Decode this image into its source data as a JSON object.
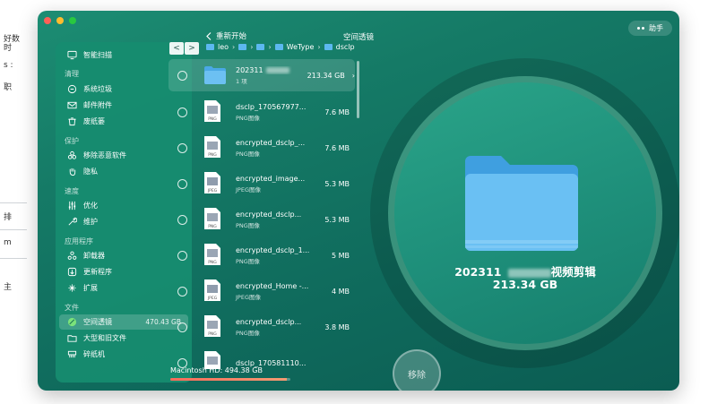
{
  "background_window": {
    "fragments": [
      "好数",
      "时",
      "s :",
      "职",
      "排",
      "m",
      "主"
    ]
  },
  "app": {
    "window_title": "空间透镜",
    "back_label": "重新开始",
    "assistant_label": "助手",
    "accent_color": "#157a66"
  },
  "sidebar": {
    "top_item": "智能扫描",
    "sections": [
      {
        "title": "清理",
        "items": [
          "系统垃圾",
          "邮件附件",
          "废纸篓"
        ]
      },
      {
        "title": "保护",
        "items": [
          "移除恶意软件",
          "隐私"
        ]
      },
      {
        "title": "速度",
        "items": [
          "优化",
          "维护"
        ]
      },
      {
        "title": "应用程序",
        "items": [
          "卸载器",
          "更新程序",
          "扩展"
        ]
      },
      {
        "title": "文件",
        "items": [
          "空间透镜",
          "大型和旧文件",
          "碎纸机"
        ]
      }
    ],
    "active_item_meta": "470.43 GB"
  },
  "breadcrumb": {
    "back_arrow": "<",
    "forward_arrow": ">",
    "items": [
      "leo",
      "",
      "",
      "WeType",
      "dsclp"
    ]
  },
  "files": [
    {
      "name": "202311",
      "sub": "1 项",
      "size": "213.34 GB",
      "type": "folder"
    },
    {
      "name": "dsclp_170567977...",
      "sub": "PNG图像",
      "size": "7.6 MB",
      "type": "png"
    },
    {
      "name": "encrypted_dsclp_...",
      "sub": "PNG图像",
      "size": "7.6 MB",
      "type": "png"
    },
    {
      "name": "encrypted_image...",
      "sub": "JPEG图像",
      "size": "5.3 MB",
      "type": "jpeg"
    },
    {
      "name": "encrypted_dsclp...",
      "sub": "PNG图像",
      "size": "5.3 MB",
      "type": "png"
    },
    {
      "name": "encrypted_dsclp_1...",
      "sub": "PNG图像",
      "size": "5 MB",
      "type": "png"
    },
    {
      "name": "encrypted_Home -...",
      "sub": "JPEG图像",
      "size": "4 MB",
      "type": "jpeg"
    },
    {
      "name": "encrypted_dsclp...",
      "sub": "PNG图像",
      "size": "3.8 MB",
      "type": "png"
    },
    {
      "name": "dsclp_170581110...",
      "sub": "",
      "size": "",
      "type": "png"
    }
  ],
  "disk": {
    "label": "Macintosh HD: 494.38 GB",
    "used_fraction": 0.97
  },
  "visual": {
    "name_prefix": "202311",
    "name_suffix": "视频剪辑",
    "size": "213.34 GB"
  },
  "remove_label": "移除",
  "icon_labels": {
    "png": "PNG",
    "jpeg": "JPEG"
  }
}
